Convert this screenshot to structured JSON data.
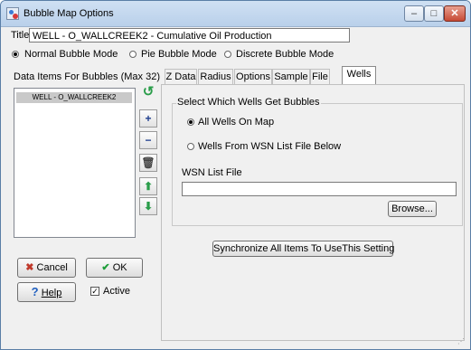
{
  "window": {
    "title": "Bubble Map Options"
  },
  "title_field": {
    "label": "Title",
    "value": "WELL - O_WALLCREEK2 - Cumulative Oil Production"
  },
  "modes": [
    {
      "label": "Normal Bubble Mode",
      "selected": true
    },
    {
      "label": "Pie Bubble Mode",
      "selected": false
    },
    {
      "label": "Discrete Bubble Mode",
      "selected": false
    }
  ],
  "data_items": {
    "header": "Data Items For Bubbles (Max 32)",
    "items": [
      "WELL - O_WALLCREEK2"
    ]
  },
  "side_buttons": [
    "undo-icon",
    "plus-icon",
    "minus-icon",
    "trash-icon",
    "arrow-up-icon",
    "arrow-down-icon"
  ],
  "tabs": [
    {
      "label": "Z Data",
      "active": false
    },
    {
      "label": "Radius",
      "active": false
    },
    {
      "label": "Options",
      "active": false
    },
    {
      "label": "Sample",
      "active": false
    },
    {
      "label": "File",
      "active": false
    },
    {
      "label": "Wells",
      "active": true
    }
  ],
  "wells": {
    "group_title": "Select Which Wells Get Bubbles",
    "options": [
      {
        "label": "All Wells On Map",
        "selected": true
      },
      {
        "label": "Wells From WSN List File  Below",
        "selected": false
      }
    ],
    "wsn_label": "WSN List File",
    "wsn_value": "",
    "browse_label": "Browse...",
    "sync_label": "Synchronize All Items To UseThis Setting"
  },
  "buttons": {
    "cancel": "Cancel",
    "ok": "OK",
    "help": "Help"
  },
  "active": {
    "label": "Active",
    "checked": true
  },
  "colors": {
    "cancel_x": "#c0392b",
    "ok_check": "#1e9e3a",
    "help_q": "#1f5fbf",
    "arrow_green": "#2a9d4a"
  }
}
